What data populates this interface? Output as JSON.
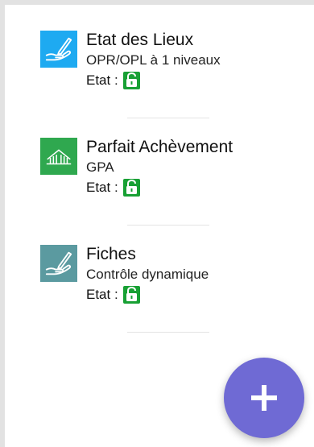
{
  "items": [
    {
      "title": "Etat des Lieux",
      "subtitle": "OPR/OPL à 1 niveaux",
      "state_label": "Etat :",
      "icon": "hand-pen-icon",
      "icon_bg": "#1eaaf1",
      "lock_state": "unlocked"
    },
    {
      "title": "Parfait Achèvement",
      "subtitle": "GPA",
      "state_label": "Etat :",
      "icon": "building-icon",
      "icon_bg": "#2fa84f",
      "lock_state": "unlocked"
    },
    {
      "title": "Fiches",
      "subtitle": "Contrôle dynamique",
      "state_label": "Etat :",
      "icon": "hand-pen-icon",
      "icon_bg": "#5b9aa0",
      "lock_state": "unlocked"
    }
  ],
  "fab": {
    "icon": "plus-icon",
    "color": "#6f6ad4"
  },
  "colors": {
    "lock": "#18a034",
    "border": "#e2e2e2"
  }
}
